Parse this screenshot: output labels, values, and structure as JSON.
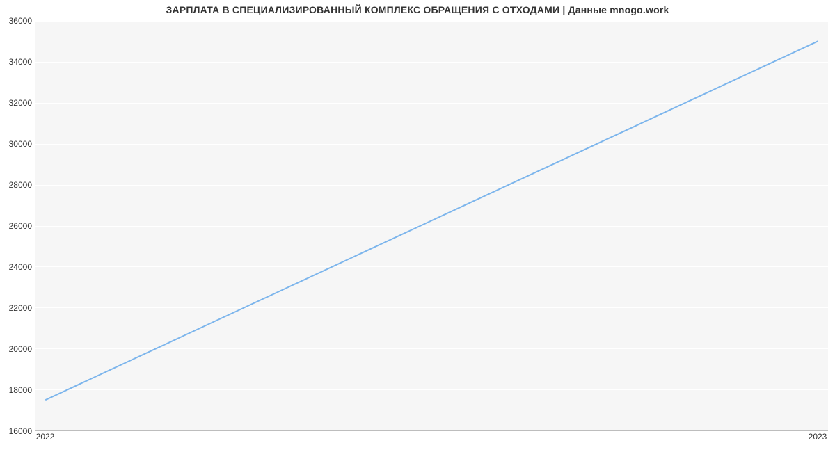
{
  "chart_data": {
    "type": "line",
    "title": "ЗАРПЛАТА В СПЕЦИАЛИЗИРОВАННЫЙ КОМПЛЕКС ОБРАЩЕНИЯ С ОТХОДАМИ | Данные mnogo.work",
    "xlabel": "",
    "ylabel": "",
    "x": [
      "2022",
      "2023"
    ],
    "values": [
      17500,
      35000
    ],
    "y_ticks": [
      16000,
      18000,
      20000,
      22000,
      24000,
      26000,
      28000,
      30000,
      32000,
      34000,
      36000
    ],
    "x_ticks": [
      "2022",
      "2023"
    ],
    "ylim": [
      16000,
      36000
    ],
    "colors": {
      "line": "#7cb5ec",
      "plot_bg": "#f6f6f6",
      "grid": "#ffffff"
    }
  }
}
